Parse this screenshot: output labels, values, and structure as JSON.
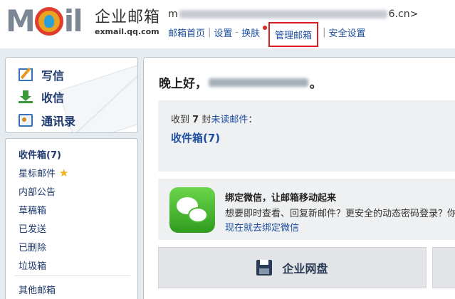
{
  "header": {
    "logo_text": "M  il",
    "brand_cn": "企业邮箱",
    "brand_url": "exmail.qq.com",
    "account_prefix": "m",
    "account_suffix": "6.cn>",
    "nav": {
      "home": "邮箱首页",
      "settings": "设置",
      "skin": "换肤",
      "manage": "管理邮箱",
      "security": "安全设置"
    }
  },
  "actions": {
    "write": "写信",
    "receive": "收信",
    "contacts": "通讯录"
  },
  "folders": {
    "inbox": "收件箱(7)",
    "starred": "星标邮件",
    "announcements": "内部公告",
    "drafts": "草稿箱",
    "sent": "已发送",
    "deleted": "已删除",
    "spam": "垃圾箱",
    "other": "其他邮箱"
  },
  "main": {
    "greeting": "晚上好，",
    "greeting_tail": "。",
    "unread_prefix": "收到",
    "unread_count": "7",
    "unread_mid": "封",
    "unread_link": "未读邮件",
    "unread_colon": "：",
    "inbox_link": "收件箱(7)",
    "wechat_title": "绑定微信，让邮箱移动起来",
    "wechat_desc": "想要即时查看、回复新邮件？更安全的动态密码登录？你",
    "wechat_link": "现在就去绑定微信",
    "disk_label": "企业网盘"
  },
  "colors": {
    "link": "#1e4fa0",
    "highlight_border": "#d81e1e",
    "panel_bg": "#eef0f2"
  }
}
